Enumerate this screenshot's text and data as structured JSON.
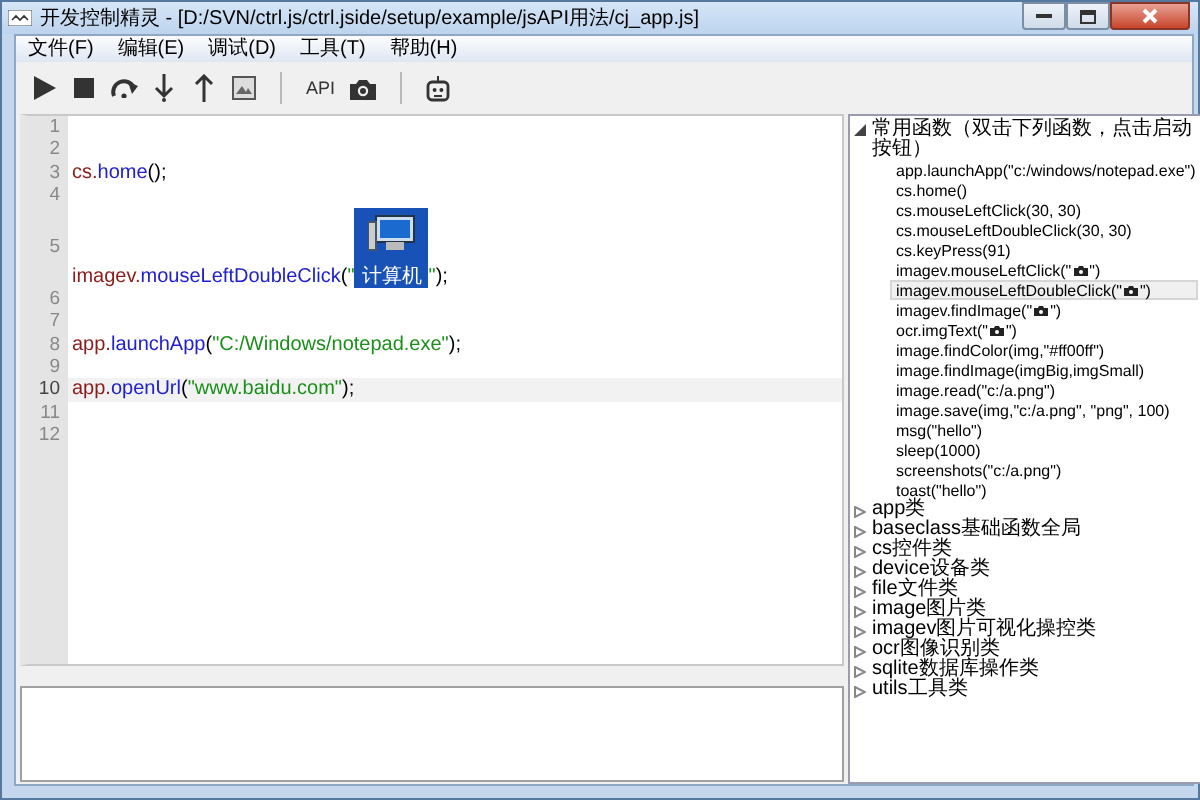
{
  "window": {
    "title": "开发控制精灵 - [D:/SVN/ctrl.js/ctrl.jside/setup/example/jsAPI用法/cj_app.js]"
  },
  "menu": [
    {
      "label": "文件(F)"
    },
    {
      "label": "编辑(E)"
    },
    {
      "label": "调试(D)"
    },
    {
      "label": "工具(T)"
    },
    {
      "label": "帮助(H)"
    }
  ],
  "toolbar": {
    "api_label": "API"
  },
  "editor": {
    "lines": [
      {
        "number": "1",
        "current": false
      },
      {
        "number": "2",
        "current": false
      },
      {
        "number": "3",
        "current": false,
        "tokens": [
          {
            "kind": "object",
            "text": "cs."
          },
          {
            "kind": "method",
            "text": "home"
          },
          {
            "kind": "punct",
            "text": "();"
          }
        ]
      },
      {
        "number": "4",
        "current": false
      },
      {
        "number": "5",
        "current": false,
        "tokens": [
          {
            "kind": "object",
            "text": "imagev."
          },
          {
            "kind": "method",
            "text": "mouseLeftDoubleClick"
          },
          {
            "kind": "punct",
            "text": "("
          },
          {
            "kind": "string",
            "text": "\""
          },
          {
            "kind": "image",
            "text": "计算机"
          },
          {
            "kind": "string",
            "text": "\""
          },
          {
            "kind": "punct",
            "text": ");"
          }
        ]
      },
      {
        "number": "6",
        "current": false
      },
      {
        "number": "7",
        "current": false
      },
      {
        "number": "8",
        "current": false,
        "tokens": [
          {
            "kind": "object",
            "text": "app."
          },
          {
            "kind": "method",
            "text": "launchApp"
          },
          {
            "kind": "punct",
            "text": "("
          },
          {
            "kind": "string",
            "text": "\"C:/Windows/notepad.exe\""
          },
          {
            "kind": "punct",
            "text": ");"
          }
        ]
      },
      {
        "number": "9",
        "current": false
      },
      {
        "number": "10",
        "current": true,
        "tokens": [
          {
            "kind": "object",
            "text": "app."
          },
          {
            "kind": "method",
            "text": "openUrl"
          },
          {
            "kind": "punct",
            "text": "("
          },
          {
            "kind": "string",
            "text": "\"www.baidu.com\""
          },
          {
            "kind": "punct",
            "text": ");"
          }
        ]
      },
      {
        "number": "11",
        "current": false
      },
      {
        "number": "12",
        "current": false
      }
    ]
  },
  "tree": [
    {
      "label": "常用函数（双击下列函数，点击启动按钮）",
      "expanded": true,
      "children": [
        {
          "kind": "plain",
          "text": "app.launchApp(\"c:/windows/notepad.exe\")",
          "selected": false
        },
        {
          "kind": "plain",
          "text": "cs.home()",
          "selected": false
        },
        {
          "kind": "plain",
          "text": "cs.mouseLeftClick(30, 30)",
          "selected": false
        },
        {
          "kind": "plain",
          "text": "cs.mouseLeftDoubleClick(30, 30)",
          "selected": false
        },
        {
          "kind": "plain",
          "text": "cs.keyPress(91)",
          "selected": false
        },
        {
          "kind": "image-arg",
          "text": "imagev.mouseLeftClick(\"",
          "after": "\")",
          "selected": false
        },
        {
          "kind": "image-arg",
          "text": "imagev.mouseLeftDoubleClick(\"",
          "after": "\")",
          "selected": true
        },
        {
          "kind": "image-arg",
          "text": "imagev.findImage(\"",
          "after": "\")",
          "selected": false
        },
        {
          "kind": "image-arg",
          "text": "ocr.imgText(\"",
          "after": "\")",
          "selected": false
        },
        {
          "kind": "plain",
          "text": "image.findColor(img,\"#ff00ff\")",
          "selected": false
        },
        {
          "kind": "plain",
          "text": "image.findImage(imgBig,imgSmall)",
          "selected": false
        },
        {
          "kind": "plain",
          "text": "image.read(\"c:/a.png\")",
          "selected": false
        },
        {
          "kind": "plain",
          "text": "image.save(img,\"c:/a.png\", \"png\", 100)",
          "selected": false
        },
        {
          "kind": "plain",
          "text": "msg(\"hello\")",
          "selected": false
        },
        {
          "kind": "plain",
          "text": "sleep(1000)",
          "selected": false
        },
        {
          "kind": "plain",
          "text": "screenshots(\"c:/a.png\")",
          "selected": false
        },
        {
          "kind": "plain",
          "text": "toast(\"hello\")",
          "selected": false
        }
      ]
    },
    {
      "label": "app类",
      "expanded": false
    },
    {
      "label": "baseclass基础函数全局",
      "expanded": false
    },
    {
      "label": "cs控件类",
      "expanded": false
    },
    {
      "label": "device设备类",
      "expanded": false
    },
    {
      "label": "file文件类",
      "expanded": false
    },
    {
      "label": "image图片类",
      "expanded": false
    },
    {
      "label": "imagev图片可视化操控类",
      "expanded": false
    },
    {
      "label": "ocr图像识别类",
      "expanded": false
    },
    {
      "label": "sqlite数据库操作类",
      "expanded": false
    },
    {
      "label": "utils工具类",
      "expanded": false
    }
  ]
}
